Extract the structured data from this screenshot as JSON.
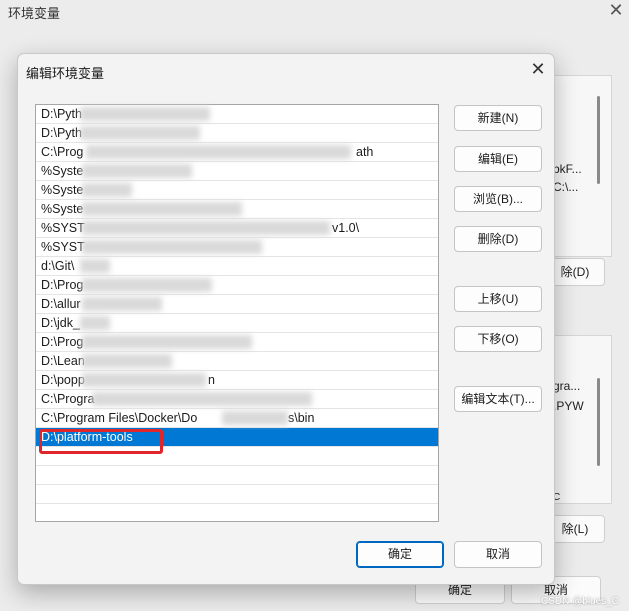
{
  "background_window": {
    "title": "环境变量",
    "fragments": {
      "user_vars_delete": "除(D)",
      "text1": "bkF...",
      "text2": "C:\\...",
      "text3": "gra...",
      "text4": ".PYW",
      "text5": "C",
      "sys_vars_delete": "除(L)",
      "ok": "确定",
      "cancel": "取消"
    }
  },
  "dialog": {
    "title": "编辑环境变量",
    "path_entries": [
      "D:\\Pyth",
      "D:\\Pyth",
      "C:\\Prog",
      "%Syste",
      "%Syste",
      "%Syste",
      "%SYST",
      "%SYST",
      "d:\\Git\\",
      "D:\\Prog",
      "D:\\allur",
      "D:\\jdk_",
      "D:\\Prog",
      "D:\\Lean",
      "D:\\popp",
      "C:\\Progra",
      "C:\\Program Files\\Docker\\Do",
      "D:\\platform-tools"
    ],
    "row_tails": {
      "row3": "ath",
      "row7": "v1.0\\",
      "row17": "s\\bin",
      "row15": "n"
    },
    "selected_entry_index": 17,
    "buttons": {
      "new": "新建(N)",
      "edit": "编辑(E)",
      "browse": "浏览(B)...",
      "delete": "删除(D)",
      "move_up": "上移(U)",
      "move_down": "下移(O)",
      "edit_text": "编辑文本(T)..."
    },
    "ok": "确定",
    "cancel": "取消"
  },
  "watermark": "CSDN @blues_C"
}
